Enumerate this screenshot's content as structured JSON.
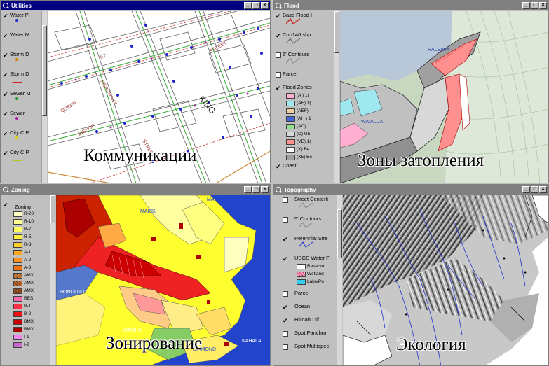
{
  "windows": {
    "utilities": {
      "title": "Utilities",
      "layers": [
        {
          "name": "Water P",
          "checked": true,
          "symbol": "dot",
          "color": "#2233cc"
        },
        {
          "name": "Water M",
          "checked": true,
          "symbol": "line",
          "color": "#2233cc"
        },
        {
          "name": "Storm D",
          "checked": true,
          "symbol": "dot",
          "color": "#cc8800"
        },
        {
          "name": "Storm D",
          "checked": true,
          "symbol": "line",
          "color": "#cc2222"
        },
        {
          "name": "Sewer M",
          "checked": true,
          "symbol": "dot",
          "color": "#339933"
        },
        {
          "name": "Sewer",
          "checked": true,
          "symbol": "dot",
          "color": "#aa22aa"
        },
        {
          "name": "City CIP",
          "checked": true,
          "symbol": "dot",
          "color": "#ddcc00"
        },
        {
          "name": "City CIP",
          "checked": true,
          "symbol": "line",
          "color": "#aacc22"
        }
      ],
      "street_labels": [
        "QUEEN",
        "MERCHANT",
        "BISHOP",
        "STREET",
        "KING",
        "ST.",
        "STREET"
      ],
      "caption": "Коммуникации"
    },
    "flood": {
      "title": "Flood",
      "layers": [
        {
          "name": "Base Flood I",
          "checked": true,
          "symbol": "zig",
          "color": "#cc2222"
        },
        {
          "name": "Con140.shp",
          "checked": true,
          "symbol": "zig",
          "color": "#666666"
        },
        {
          "name": "5' Contours",
          "checked": false,
          "symbol": "zig",
          "color": "#888888"
        },
        {
          "name": "Parcel",
          "checked": false,
          "symbol": "none",
          "color": ""
        },
        {
          "name": "Flood Zones",
          "checked": true,
          "symbol": "none",
          "color": ""
        }
      ],
      "zones": [
        {
          "label": "(A ) 1(",
          "color": "#ffb0d0"
        },
        {
          "label": "(AE) 1(",
          "color": "#a0e8f0"
        },
        {
          "label": "(AEF)",
          "color": "#f0d0a0"
        },
        {
          "label": "(AH ) 1",
          "color": "#4466dd"
        },
        {
          "label": "(AO) 1",
          "color": "#90e090"
        },
        {
          "label": "(D) Un",
          "color": "#d8d8d8"
        },
        {
          "label": "(VE) 1(",
          "color": "#ff9090"
        },
        {
          "label": "(X) Be",
          "color": "#ffffff"
        },
        {
          "label": "(X5) Be",
          "color": "#a0a0a0"
        }
      ],
      "more_layer": "Coast",
      "place_labels": [
        "HALEIWA",
        "WAIALUA"
      ],
      "caption": "Зоны затопления"
    },
    "zoning": {
      "title": "Zoning",
      "layer_name": "Zoning",
      "classes": [
        {
          "label": "R-20",
          "color": "#ffffc0"
        },
        {
          "label": "R-10",
          "color": "#ffff90"
        },
        {
          "label": "R-7.",
          "color": "#ffff60"
        },
        {
          "label": "R-5",
          "color": "#ffee40"
        },
        {
          "label": "R-3.",
          "color": "#ffcc30"
        },
        {
          "label": "A-1",
          "color": "#ffaa20"
        },
        {
          "label": "A-2",
          "color": "#ff9020"
        },
        {
          "label": "A-3",
          "color": "#ee7010"
        },
        {
          "label": "AMX",
          "color": "#dd8840"
        },
        {
          "label": "AMX",
          "color": "#cc7030"
        },
        {
          "label": "AMX",
          "color": "#aa5522"
        },
        {
          "label": "RES",
          "color": "#ff66aa"
        },
        {
          "label": "B-1",
          "color": "#ff3344"
        },
        {
          "label": "B-2",
          "color": "#ee1111"
        },
        {
          "label": "BMX",
          "color": "#cc0000"
        },
        {
          "label": "BMX",
          "color": "#aa0000"
        },
        {
          "label": "I-1",
          "color": "#ee88ee"
        },
        {
          "label": "I-2",
          "color": "#cc66cc"
        }
      ],
      "place_labels": [
        "MAKIKI",
        "MANOA",
        "HONOLULU",
        "WAIKIKI",
        "KAHALA",
        "DIAMOND"
      ],
      "caption": "Зонирование"
    },
    "topography": {
      "title": "Topography",
      "layers": [
        {
          "name": "Street Centerli",
          "checked": false,
          "symbol": "zig",
          "color": "#888888"
        },
        {
          "name": "5' Contours",
          "checked": false,
          "symbol": "zig",
          "color": "#888888"
        },
        {
          "name": "Perennial Stre",
          "checked": true,
          "symbol": "zig",
          "color": "#2233cc"
        },
        {
          "name": "USGS Water F",
          "checked": true,
          "symbol": "none",
          "color": ""
        }
      ],
      "water_classes": [
        {
          "label": "Reservo",
          "color": "#ffffff"
        },
        {
          "label": "Wetland",
          "color": "#ffaacc"
        },
        {
          "label": "Lake/Po",
          "color": "#33ccee"
        }
      ],
      "more_layers": [
        {
          "name": "Parcel",
          "checked": false
        },
        {
          "name": "Ocean",
          "checked": true
        },
        {
          "name": "Hilloahu.tif",
          "checked": true
        },
        {
          "name": "Spot Panchror",
          "checked": false
        },
        {
          "name": "Spot Multispec",
          "checked": false
        }
      ],
      "caption": "Экология"
    }
  },
  "controls": {
    "minimize": "_",
    "maximize": "□",
    "close": "×"
  },
  "icons": {
    "app": "magnifier-icon",
    "check": "✔"
  }
}
